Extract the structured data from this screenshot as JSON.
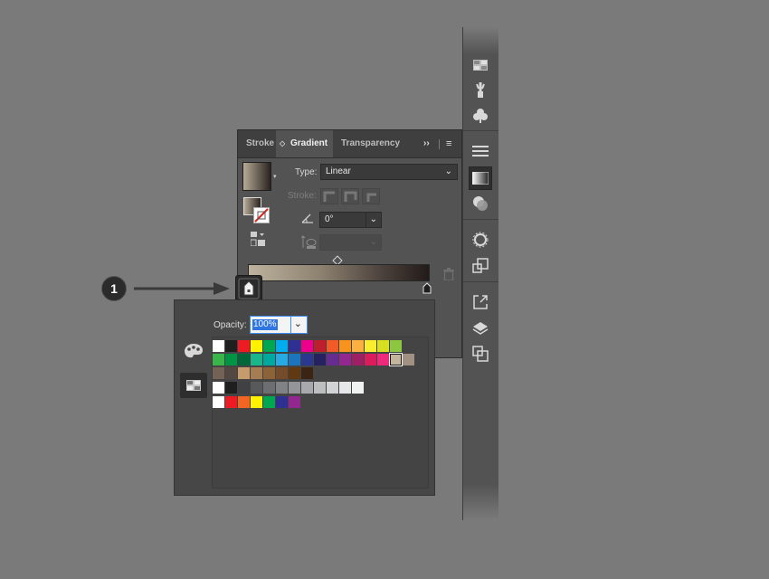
{
  "gradient_panel": {
    "tabs": [
      {
        "label": "Stroke"
      },
      {
        "label": "Gradient"
      },
      {
        "label": "Transparency"
      }
    ],
    "type_label": "Type:",
    "type_value": "Linear",
    "stroke_label": "Stroke:",
    "angle_value": "0°"
  },
  "color_panel": {
    "opacity_label": "Opacity:",
    "opacity_value": "100%",
    "swatch_rows": [
      [
        "#ffffff",
        "#1f1f1f",
        "#ed1c24",
        "#fff200",
        "#00a651",
        "#00aeef",
        "#2e3192",
        "#ec008c",
        "#be1e2d",
        "#f15a29",
        "#f7941d",
        "#fbb040",
        "#f9ed32",
        "#d7df23",
        "#8dc63f"
      ],
      [
        "#39b54a",
        "#009444",
        "#006838",
        "#1bb58a",
        "#00a99d",
        "#27aae1",
        "#1c75bc",
        "#2b388f",
        "#262262",
        "#662d91",
        "#92278f",
        "#9e1f63",
        "#da1c5c",
        "#ee2a7b",
        "#c2b59b",
        "#a19183"
      ],
      [
        "#736357",
        "#534741",
        "#c69c6d",
        "#a67c52",
        "#8c6239",
        "#754c29",
        "#603913",
        "#3c2415"
      ],
      [
        "#ffffff",
        "#1f1f1f",
        "#414042",
        "#58595b",
        "#6d6e71",
        "#808285",
        "#939598",
        "#a7a9ac",
        "#bcbec0",
        "#d1d3d4",
        "#e6e7e8",
        "#f1f2f2"
      ],
      [
        "#ffffff",
        "#ed1c24",
        "#f26522",
        "#fff200",
        "#00a651",
        "#2e3192",
        "#92278f"
      ]
    ],
    "selected_swatch": "#c2b59b"
  },
  "callout": {
    "number": "1"
  },
  "colors": {
    "background": "#7a7a7a",
    "panel": "#535353",
    "highlight": "#2f76e3"
  },
  "icons": {
    "tools": [
      "swatches-panel-icon",
      "paintbrush-icon",
      "symbols-club-icon",
      "stroke-icon",
      "gradient-icon",
      "transparency-icon",
      "appearance-icon",
      "graphic-styles-icon",
      "export-icon",
      "layers-icon",
      "artboards-icon"
    ]
  }
}
